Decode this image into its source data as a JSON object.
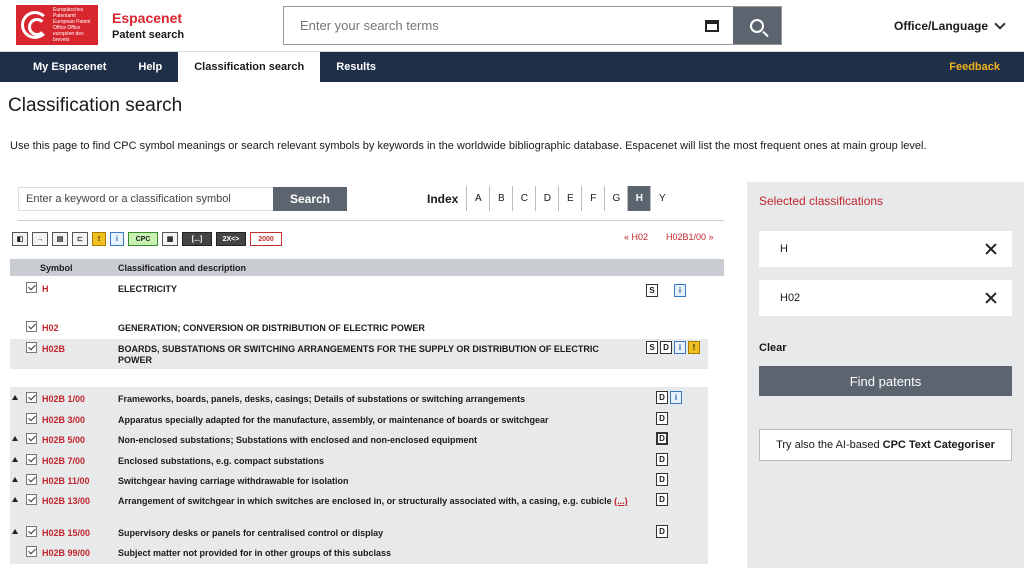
{
  "header": {
    "logo_text": "Europäisches Patentamt European Patent Office Office européen des brevets",
    "brand_name": "Espacenet",
    "brand_sub": "Patent search",
    "search_placeholder": "Enter your search terms",
    "office_language": "Office/Language"
  },
  "nav": {
    "items": [
      "My Espacenet",
      "Help",
      "Classification search",
      "Results"
    ],
    "active": "Classification search",
    "feedback": "Feedback"
  },
  "page": {
    "title": "Classification search",
    "intro": "Use this page to find CPC symbol meanings or search relevant symbols by keywords in the worldwide bibliographic database. Espacenet will list the most frequent ones at main group level."
  },
  "keyword_search": {
    "placeholder": "Enter a keyword or a classification symbol",
    "button": "Search"
  },
  "index": {
    "label": "Index",
    "letters": [
      "A",
      "B",
      "C",
      "D",
      "E",
      "F",
      "G",
      "H",
      "Y"
    ],
    "active": "H"
  },
  "toolbar": {
    "cpc": "CPC",
    "ellipsis": "[...]",
    "zoom": "2X<>",
    "year": "2000"
  },
  "pager": {
    "prev": "« H02",
    "next": "H02B1/00 »"
  },
  "table": {
    "col_symbol": "Symbol",
    "col_desc": "Classification and description",
    "rows": [
      {
        "symbol": "H",
        "desc": "ELECTRICITY"
      },
      {
        "symbol": "H02",
        "desc": "GENERATION; CONVERSION OR DISTRIBUTION OF ELECTRIC POWER"
      },
      {
        "symbol": "H02B",
        "desc": "BOARDS, SUBSTATIONS OR SWITCHING ARRANGEMENTS FOR THE SUPPLY OR DISTRIBUTION OF ELECTRIC POWER"
      },
      {
        "symbol": "H02B 1/00",
        "desc": "Frameworks, boards, panels, desks, casings; Details of substations or switching arrangements"
      },
      {
        "symbol": "H02B 3/00",
        "desc": "Apparatus specially adapted for the manufacture, assembly, or maintenance of boards or switchgear"
      },
      {
        "symbol": "H02B 5/00",
        "desc": "Non-enclosed substations; Substations with enclosed and non-enclosed equipment"
      },
      {
        "symbol": "H02B 7/00",
        "desc": "Enclosed substations, e.g. compact substations"
      },
      {
        "symbol": "H02B 11/00",
        "desc": "Switchgear having carriage withdrawable for isolation"
      },
      {
        "symbol": "H02B 13/00",
        "desc": "Arrangement of switchgear in which switches are enclosed in, or structurally associated with, a casing, e.g. cubicle",
        "more": "(...)"
      },
      {
        "symbol": "H02B 15/00",
        "desc": "Supervisory desks or panels for centralised control or display"
      },
      {
        "symbol": "H02B 99/00",
        "desc": "Subject matter not provided for in other groups of this subclass"
      }
    ]
  },
  "sidebar": {
    "title": "Selected classifications",
    "selected": [
      "H",
      "H02"
    ],
    "clear": "Clear",
    "find": "Find patents",
    "ai_prefix": "Try also the AI-based",
    "ai_bold": "CPC Text Categoriser"
  }
}
